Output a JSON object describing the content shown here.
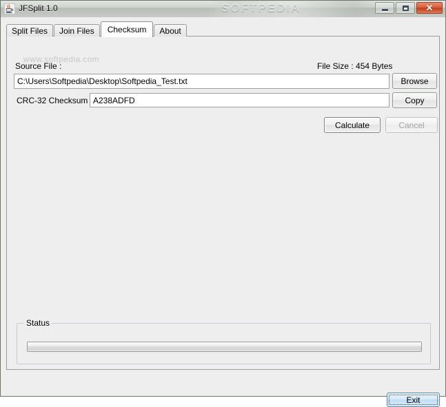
{
  "window": {
    "title": "JFSplit 1.0",
    "icon": "java-coffee-cup-icon",
    "watermark": "SOFTPEDIA",
    "controls": {
      "minimize": "–",
      "maximize": "□",
      "close": "✕"
    }
  },
  "tabs": [
    {
      "label": "Split Files",
      "selected": false
    },
    {
      "label": "Join Files",
      "selected": false
    },
    {
      "label": "Checksum",
      "selected": true
    },
    {
      "label": "About",
      "selected": false
    }
  ],
  "panel": {
    "watermark": "www.softpedia.com",
    "source_file_label": "Source File :",
    "file_size_label": "File Size : 454 Bytes",
    "source_file_value": "C:\\Users\\Softpedia\\Desktop\\Softpedia_Test.txt",
    "source_file_placeholder": "",
    "crc_label": "CRC-32 Checksum :",
    "crc_value": "A238ADFD",
    "crc_placeholder": "",
    "browse_label": "Browse",
    "copy_label": "Copy",
    "calculate_label": "Calculate",
    "cancel_label": "Cancel"
  },
  "status": {
    "legend": "Status",
    "progress_percent": 0,
    "progress_text": ""
  },
  "footer": {
    "exit_label": "Exit"
  },
  "colors": {
    "panel_background": "#eeeeee",
    "field_background": "#ffffff",
    "close_button": "#c33c1b",
    "focus_button": "#bcdcf4",
    "group_border": "#c6cbd4"
  }
}
